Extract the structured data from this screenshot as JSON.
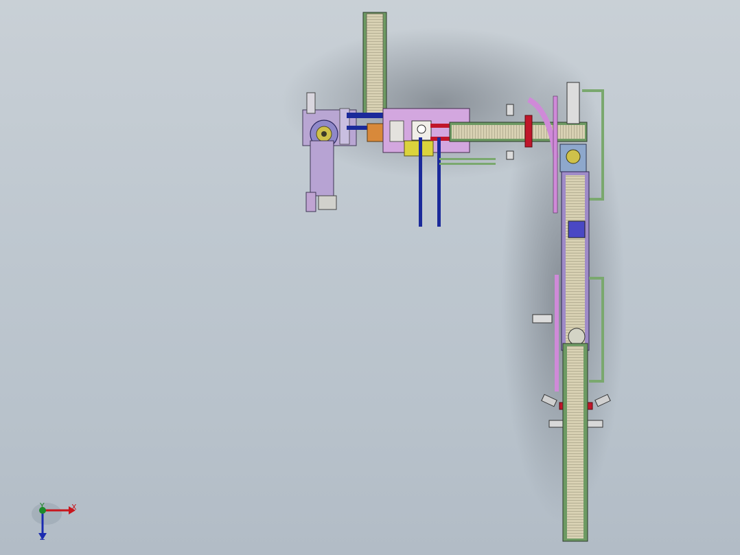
{
  "viewport": {
    "background_top": "#c9d0d6",
    "background_bottom": "#b2bcc6"
  },
  "model": {
    "description_icon": "conveyor-assembly-icon",
    "colors": {
      "frame_green": "#7aa86e",
      "belt_tan": "#cfc7a6",
      "motor_purple": "#9f8bc8",
      "bracket_pink": "#cf8ad8",
      "rail_blue": "#1b2a9a",
      "accent_red": "#c0162a",
      "accent_orange": "#d88a3a",
      "accent_yellow": "#d7cf3a"
    }
  },
  "triad": {
    "x_label": "X",
    "y_label": "Y",
    "z_label": "Z",
    "x_color": "#c8161d",
    "y_color": "#1d8a2a",
    "z_color": "#1b2bb0"
  }
}
